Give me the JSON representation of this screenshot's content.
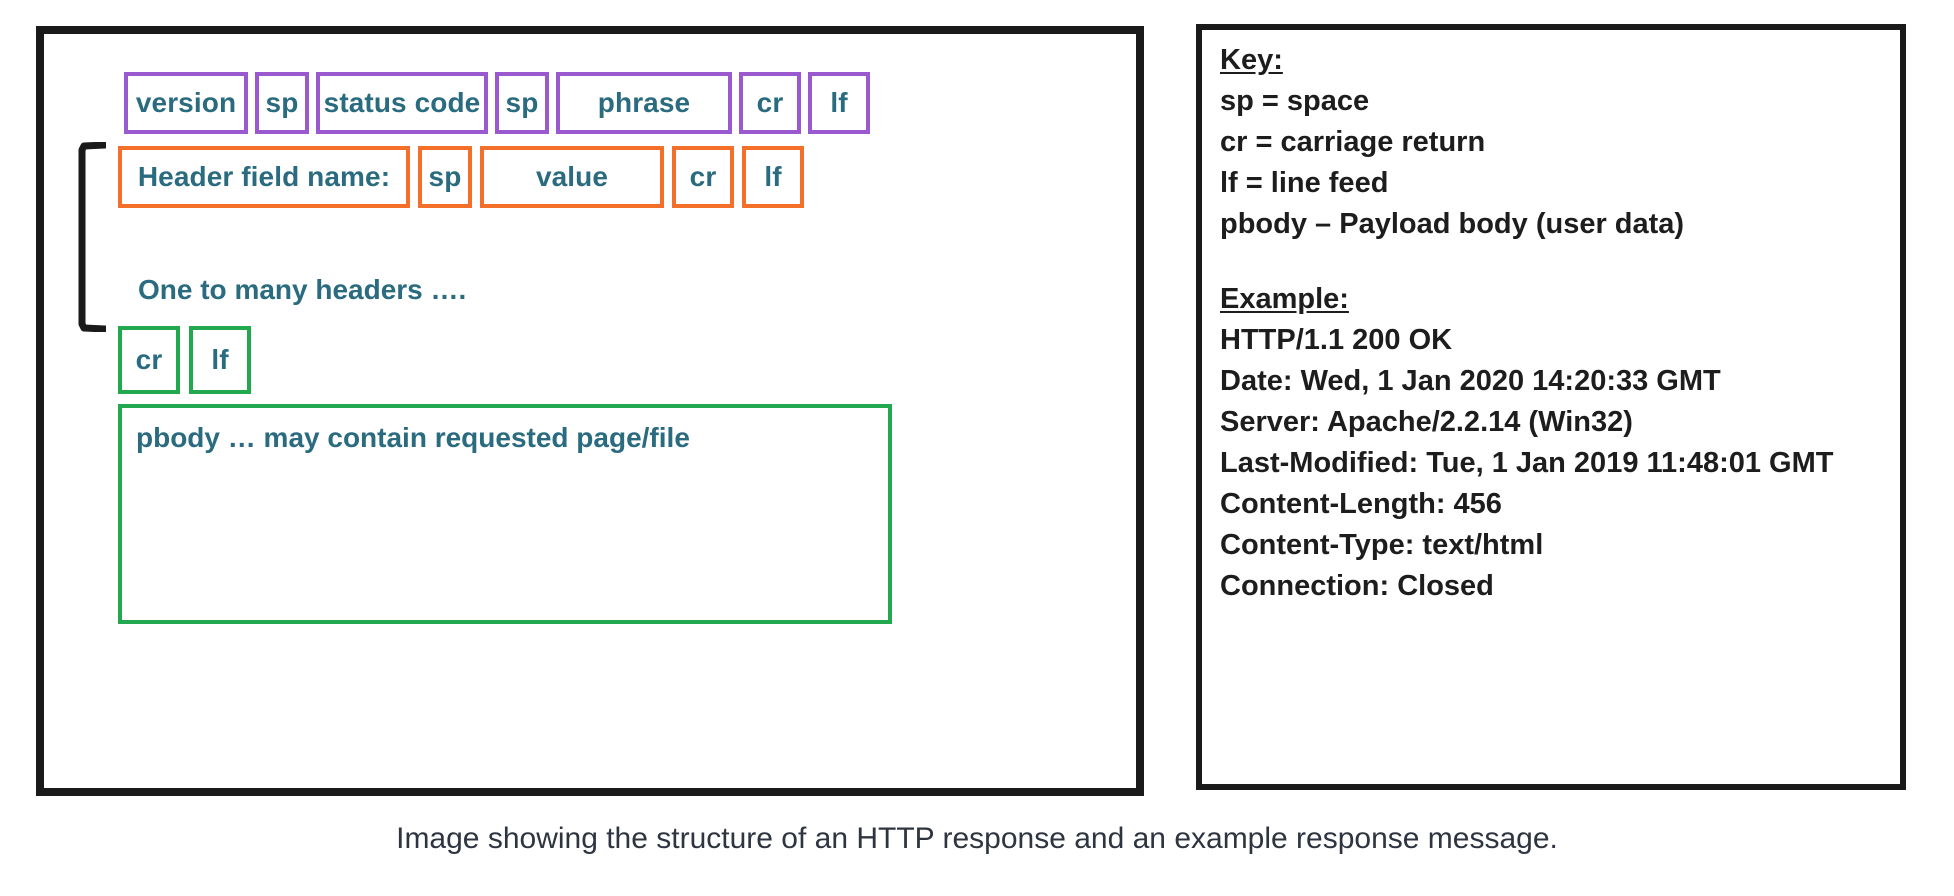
{
  "caption": "Image showing the structure of an HTTP response and an example response message.",
  "colors": {
    "frame": "#1a1a1a",
    "status_line": "#9b59d0",
    "header_line": "#f4702a",
    "body_section": "#22a84e",
    "token_text": "#2a6b7f",
    "key_text": "#1d1d1d"
  },
  "structure": {
    "status_line": {
      "color": "#9b59d0",
      "tokens": [
        {
          "label": "version"
        },
        {
          "label": "sp"
        },
        {
          "label": "status code"
        },
        {
          "label": "sp"
        },
        {
          "label": "phrase"
        },
        {
          "label": "cr"
        },
        {
          "label": "lf"
        }
      ]
    },
    "header_line": {
      "color": "#f4702a",
      "tokens": [
        {
          "label": "Header field name:"
        },
        {
          "label": "sp"
        },
        {
          "label": "value"
        },
        {
          "label": "cr"
        },
        {
          "label": "lf"
        }
      ]
    },
    "repeat_note": "One to many headers ….",
    "blank_line": {
      "color": "#22a84e",
      "tokens": [
        {
          "label": "cr"
        },
        {
          "label": "lf"
        }
      ]
    },
    "payload_body": {
      "color": "#22a84e",
      "label": "pbody … may contain requested page/file"
    }
  },
  "key_panel": {
    "key_heading": "Key:",
    "key_lines": [
      "sp = space",
      "cr = carriage return",
      "lf = line feed",
      "pbody – Payload body (user data)"
    ],
    "example_heading": "Example:",
    "example_lines": [
      "HTTP/1.1 200 OK",
      "Date: Wed, 1 Jan 2020 14:20:33 GMT",
      "Server: Apache/2.2.14 (Win32)",
      "Last-Modified: Tue, 1 Jan 2019 11:48:01 GMT",
      "Content-Length: 456",
      "Content-Type: text/html",
      "Connection: Closed"
    ]
  }
}
